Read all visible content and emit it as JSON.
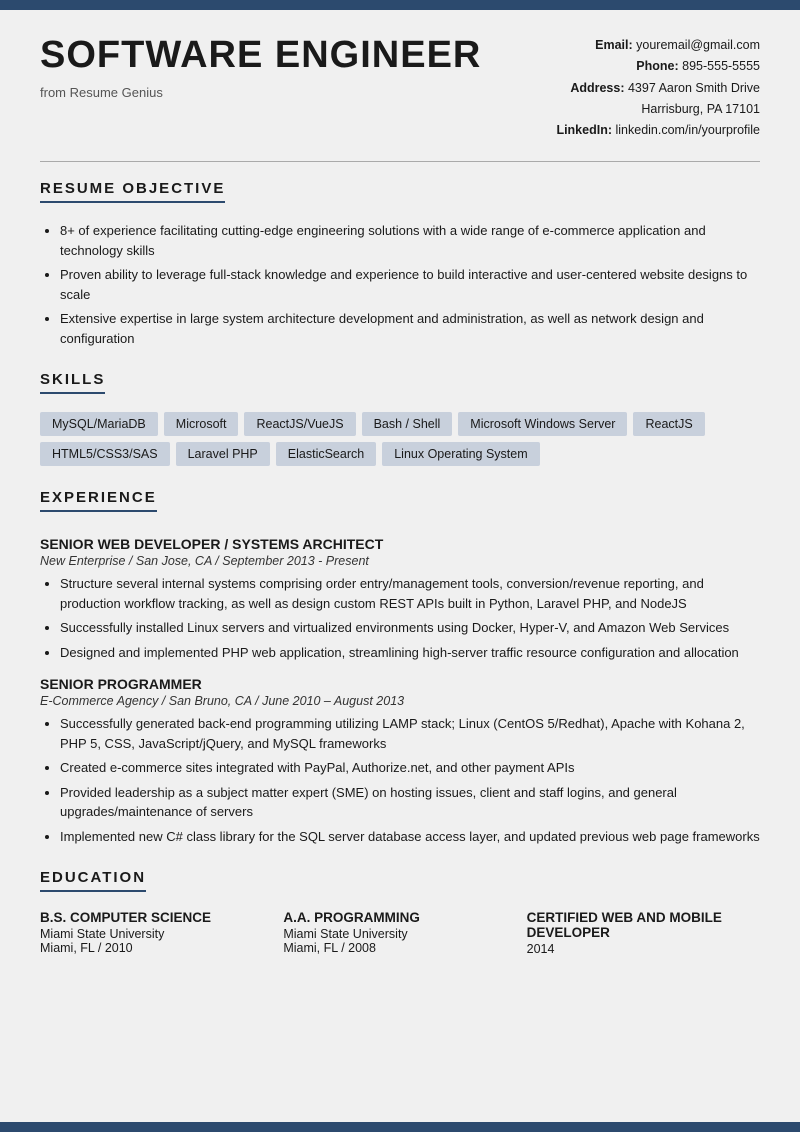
{
  "topBar": {
    "color": "#2c4a6e"
  },
  "header": {
    "name": "SOFTWARE ENGINEER",
    "subtitle": "from Resume Genius",
    "contact": {
      "email_label": "Email:",
      "email": "youremail@gmail.com",
      "phone_label": "Phone:",
      "phone": "895-555-5555",
      "address_label": "Address:",
      "address_line1": "4397 Aaron Smith Drive",
      "address_line2": "Harrisburg, PA 17101",
      "linkedin_label": "LinkedIn:",
      "linkedin": "linkedin.com/in/yourprofile"
    }
  },
  "sections": {
    "objective": {
      "title": "RESUME OBJECTIVE",
      "bullets": [
        "8+ of experience facilitating cutting-edge engineering solutions with a wide range of e-commerce application and technology skills",
        "Proven ability to leverage full-stack knowledge and experience to build interactive and user-centered website designs to scale",
        "Extensive expertise in large system architecture development and administration, as well as network design and configuration"
      ]
    },
    "skills": {
      "title": "SKILLS",
      "items": [
        "MySQL/MariaDB",
        "Microsoft",
        "ReactJS/VueJS",
        "Bash / Shell",
        "Microsoft Windows Server",
        "ReactJS",
        "HTML5/CSS3/SAS",
        "Laravel PHP",
        "ElasticSearch",
        "Linux Operating System"
      ]
    },
    "experience": {
      "title": "EXPERIENCE",
      "jobs": [
        {
          "title": "SENIOR WEB DEVELOPER / SYSTEMS ARCHITECT",
          "subtitle": "New Enterprise / San Jose, CA / September 2013 - Present",
          "bullets": [
            "Structure several internal systems comprising order entry/management tools, conversion/revenue reporting, and production workflow tracking, as well as design custom REST APIs built in Python, Laravel PHP, and NodeJS",
            "Successfully installed Linux servers and virtualized environments using Docker, Hyper-V, and Amazon Web Services",
            "Designed and implemented PHP web application, streamlining high-server traffic resource configuration and allocation"
          ]
        },
        {
          "title": "SENIOR PROGRAMMER",
          "subtitle": "E-Commerce Agency / San Bruno, CA / June 2010 – August 2013",
          "bullets": [
            "Successfully generated back-end programming utilizing LAMP stack; Linux (CentOS 5/Redhat), Apache with Kohana 2, PHP 5, CSS, JavaScript/jQuery, and MySQL frameworks",
            "Created e-commerce sites integrated with PayPal, Authorize.net, and other payment APIs",
            "Provided leadership as a subject matter expert (SME) on hosting issues, client and staff logins, and general upgrades/maintenance of servers",
            "Implemented new C# class library for the SQL server database access layer, and updated previous web page frameworks"
          ]
        }
      ]
    },
    "education": {
      "title": "EDUCATION",
      "items": [
        {
          "degree": "B.S. COMPUTER SCIENCE",
          "school": "Miami State University",
          "location": "Miami, FL / 2010"
        },
        {
          "degree": "A.A. PROGRAMMING",
          "school": "Miami State University",
          "location": "Miami, FL / 2008"
        },
        {
          "degree": "CERTIFIED WEB AND MOBILE DEVELOPER",
          "school": "",
          "location": "2014"
        }
      ]
    }
  }
}
